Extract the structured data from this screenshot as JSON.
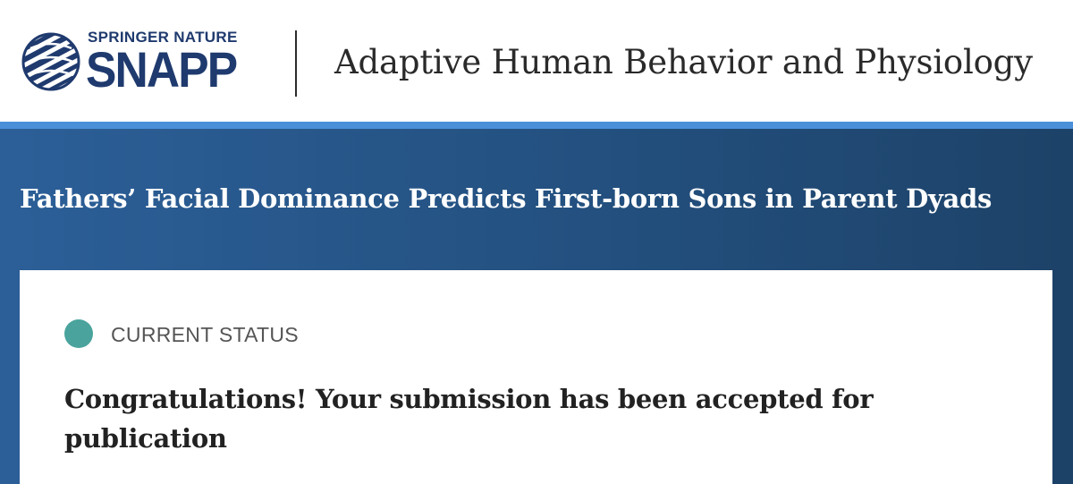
{
  "header": {
    "logo": {
      "brand_line": "SPRINGER NATURE",
      "product_name": "SNAPP",
      "icon": "springer-nature-globe-icon"
    },
    "journal_title": "Adaptive Human Behavior and Physiology"
  },
  "article": {
    "title": "Fathers’ Facial Dominance Predicts First-born Sons in Parent Dyads"
  },
  "status": {
    "label": "CURRENT STATUS",
    "indicator_color": "#4aa39d",
    "message": "Congratulations! Your submission has been accepted for publication"
  },
  "colors": {
    "brand_navy": "#1f3a6e",
    "accent_bar": "#4a90d9",
    "banner_left": "#2c5f98",
    "banner_right": "#1d4268"
  }
}
